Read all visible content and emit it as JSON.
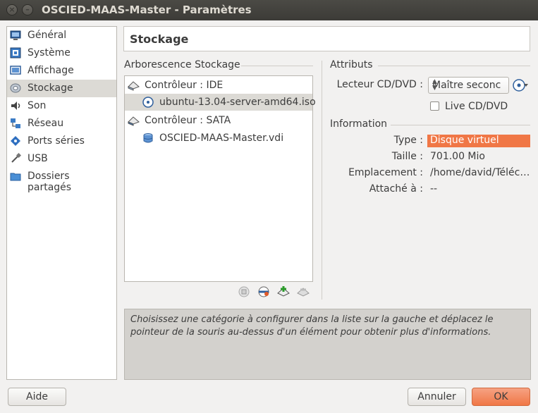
{
  "window": {
    "title": "OSCIED-MAAS-Master - Paramètres",
    "close_icon": "×",
    "minimize_icon": "–"
  },
  "sidebar": {
    "items": [
      {
        "label": "Général",
        "icon": "general-icon"
      },
      {
        "label": "Système",
        "icon": "system-icon"
      },
      {
        "label": "Affichage",
        "icon": "display-icon"
      },
      {
        "label": "Stockage",
        "icon": "storage-icon",
        "selected": true
      },
      {
        "label": "Son",
        "icon": "audio-icon"
      },
      {
        "label": "Réseau",
        "icon": "network-icon"
      },
      {
        "label": "Ports séries",
        "icon": "serial-ports-icon"
      },
      {
        "label": "USB",
        "icon": "usb-icon"
      },
      {
        "label": "Dossiers partagés",
        "icon": "shared-folder-icon"
      }
    ]
  },
  "page": {
    "title": "Stockage"
  },
  "tree": {
    "heading": "Arborescence Stockage",
    "items": [
      {
        "label": "Contrôleur : IDE"
      },
      {
        "label": "ubuntu-13.04-server-amd64.iso",
        "selected": true
      },
      {
        "label": "Contrôleur : SATA"
      },
      {
        "label": "OSCIED-MAAS-Master.vdi"
      }
    ]
  },
  "attributes": {
    "heading": "Attributs",
    "drive_label": "Lecteur CD/DVD :",
    "drive_value": "Maître seconc",
    "live_label": "Live CD/DVD"
  },
  "information": {
    "heading": "Information",
    "type_label": "Type :",
    "type_value": "Disque virtuel",
    "size_label": "Taille :",
    "size_value": "701.00 Mio",
    "location_label": "Emplacement :",
    "location_value": "/home/david/Téléc…",
    "attached_label": "Attaché à :",
    "attached_value": "--"
  },
  "hint": "Choisissez une catégorie à configurer dans la liste sur la gauche et déplacez le pointeur de la souris au-dessus d'un élément pour obtenir plus d'informations.",
  "buttons": {
    "help": "Aide",
    "cancel": "Annuler",
    "ok": "OK"
  },
  "colors": {
    "accent": "#f07746",
    "selection": "#dcdad5",
    "titlebar": "#3c3b37"
  }
}
